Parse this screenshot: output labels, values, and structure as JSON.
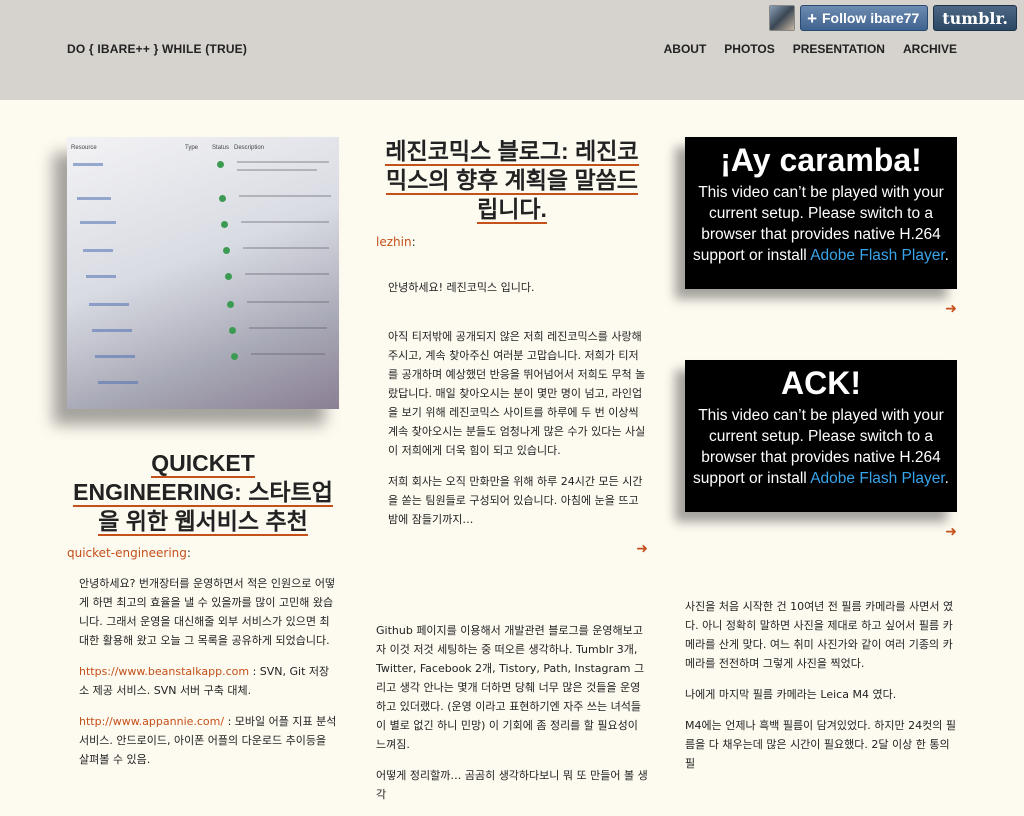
{
  "site": {
    "title": "DO { IBARE++ } WHILE (TRUE)",
    "nav": [
      "ABOUT",
      "PHOTOS",
      "PRESENTATION",
      "ARCHIVE"
    ]
  },
  "tumblr": {
    "follow_label": "Follow ibare77",
    "logo_text": "tumblr."
  },
  "col1": {
    "image_header": [
      "Resource",
      "Type",
      "Status",
      "Description"
    ],
    "image_resources": [
      "/categorys",
      "/category/",
      "/category/",
      "/category/",
      "/category/",
      "/category/",
      "/category/",
      "/category/",
      "/category/",
      "/category/"
    ],
    "title": "QUICKET ENGINEERING: 스타트업을 위한 웹서비스 추천",
    "source": "quicket-engineering",
    "source_suffix": ":",
    "p1": "안녕하세요? 번개장터를 운영하면서 적은 인원으로 어떻게 하면 최고의 효율을 낼 수 있을까를 많이 고민해 왔습니다. 그래서 운영을 대신해줄 외부 서비스가 있으면 최대한 활용해 왔고 오늘 그 목록을 공유하게 되었습니다.",
    "link1": "https://www.beanstalkapp.com",
    "p2": " : SVN, Git 저장소 제공 서비스. SVN 서버 구축 대체.",
    "link2": "http://www.appannie.com/",
    "p3": " : 모바일 어플 지표 분석 서비스. 안드로이드, 아이폰 어플의 다운로드 추이등을 살펴볼 수 있음."
  },
  "col2": {
    "title": "레진코믹스 블로그: 레진코믹스의 향후 계획을 말씀드립니다.",
    "source": "lezhin",
    "source_suffix": ":",
    "p1": "안녕하세요! 레진코믹스 입니다.",
    "p2": "아직 티저밖에 공개되지 않은 저희 레진코믹스를 사랑해주시고, 계속 찾아주신 여러분 고맙습니다. 저희가 티저를 공개하며 예상했던 반응을 뛰어넘어서 저희도 무척 놀랐답니다. 매일 찾아오시는 분이 몇만 명이 넘고, 라인업을 보기 위해 레진코믹스 사이트를 하루에 두 번 이상씩 계속 찾아오시는 분들도 엄청나게 많은 수가 있다는 사실이 저희에게 더욱 힘이 되고 있습니다.",
    "p3": "저희 회사는 오직 만화만을 위해 하루 24시간 모든 시간을 쏟는 팀원들로 구성되어 있습니다. 아침에 눈을 뜨고 밤에 잠들기까지…",
    "p4": "Github 페이지를 이용해서 개발관련 블로그를 운영해보고자 이것 저것 세팅하는 중 떠오른 생각하나. Tumblr 3개, Twitter, Facebook 2개, Tistory, Path, Instagram 그리고 생각 안나는 몇개 더하면 당췌 너무 많은 것들을 운영하고 있더랬다. (운영 이라고 표현하기엔 자주 쓰는 녀석들이 별로 없긴 하니 민망) 이 기회에 좀 정리를 할 필요성이 느껴짐.",
    "p5": "어떻게 정리할까… 곰곰히 생각하다보니 뭐 또 만들어 볼 생각"
  },
  "col3": {
    "video1_title": "¡Ay caramba!",
    "video2_title": "ACK!",
    "video_msg": "This video can’t be played with your current setup. Please switch to a browser that provides native H.264 support or install",
    "video_link": "Adobe Flash Player",
    "video_end": ".",
    "p1": "사진을 처음 시작한 건 10여년 전 필름 카메라를 사면서 였다. 아니 정확히 말하면 사진을 제대로 하고 싶어서 필름 카메라를 산게 맞다. 여느 취미 사진가와 같이 여러 기종의 카메라를 전전하며 그렇게 사진을 찍었다.",
    "p2": "나에게 마지막 필름 카메라는 Leica M4 였다.",
    "p3": "M4에는 언제나 흑백 필름이 담겨있었다. 하지만 24컷의 필름을 다 채우는데 많은 시간이 필요했다. 2달 이상 한 통의 필"
  },
  "icons": {
    "more_arrow": "➜",
    "plus": "+"
  },
  "colors": {
    "accent": "#c4501a",
    "header_bg": "#d6d3ce",
    "page_bg": "#fdfaf0",
    "video_link": "#39a4ea"
  }
}
